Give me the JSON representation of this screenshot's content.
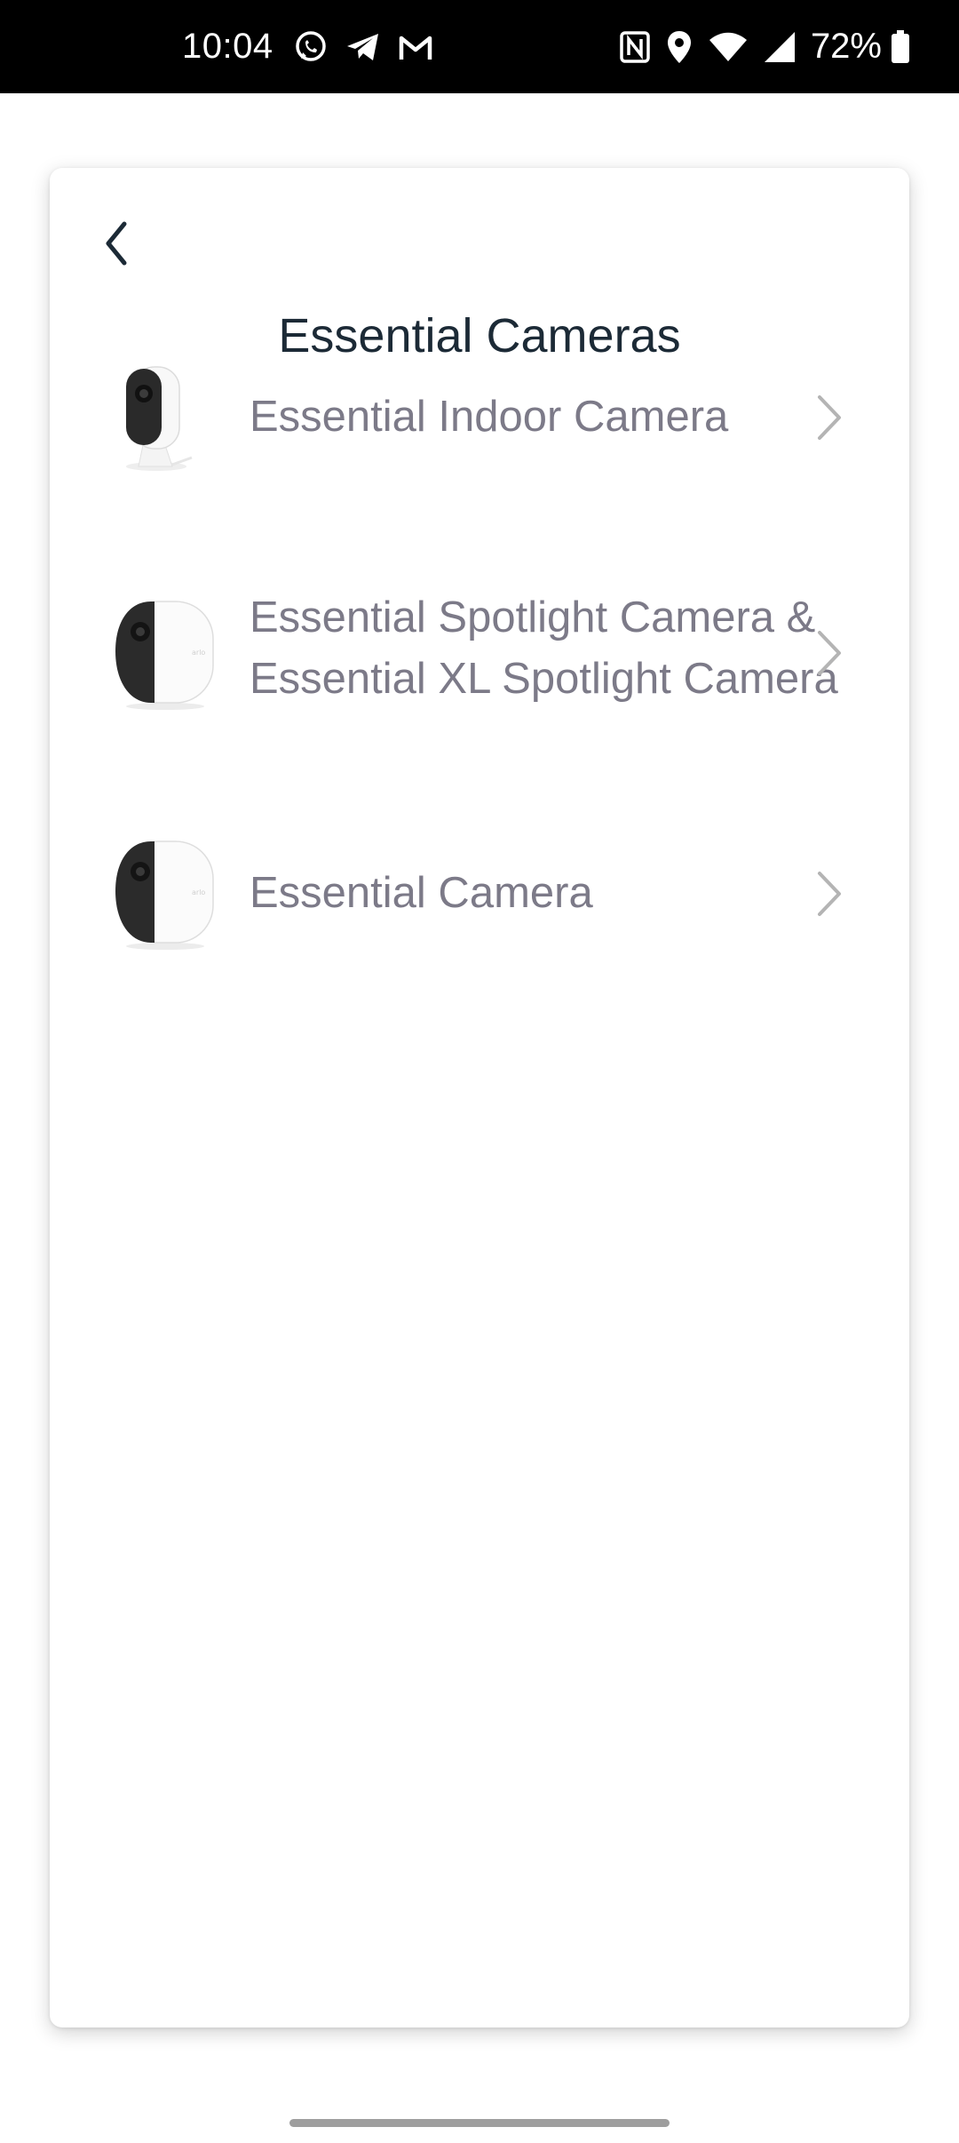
{
  "status_bar": {
    "time": "10:04",
    "battery": "72%",
    "left_icons": [
      "whatsapp-icon",
      "telegram-icon",
      "gmail-icon"
    ],
    "right_icons": [
      "nfc-icon",
      "location-icon",
      "wifi-icon",
      "signal-icon",
      "battery-icon"
    ]
  },
  "header": {
    "back_icon": "chevron-left-icon",
    "title": "Essential Cameras"
  },
  "devices": [
    {
      "label": "Essential Indoor Camera",
      "image": "indoor-camera"
    },
    {
      "label": "Essential Spotlight Camera & Essential XL Spotlight Camera",
      "image": "spotlight-camera"
    },
    {
      "label": "Essential Camera",
      "image": "essential-camera"
    }
  ],
  "colors": {
    "title": "#1c2a36",
    "item_text": "#7c7a88",
    "chevron": "#b4b4b4",
    "status_bar_bg": "#000000"
  }
}
